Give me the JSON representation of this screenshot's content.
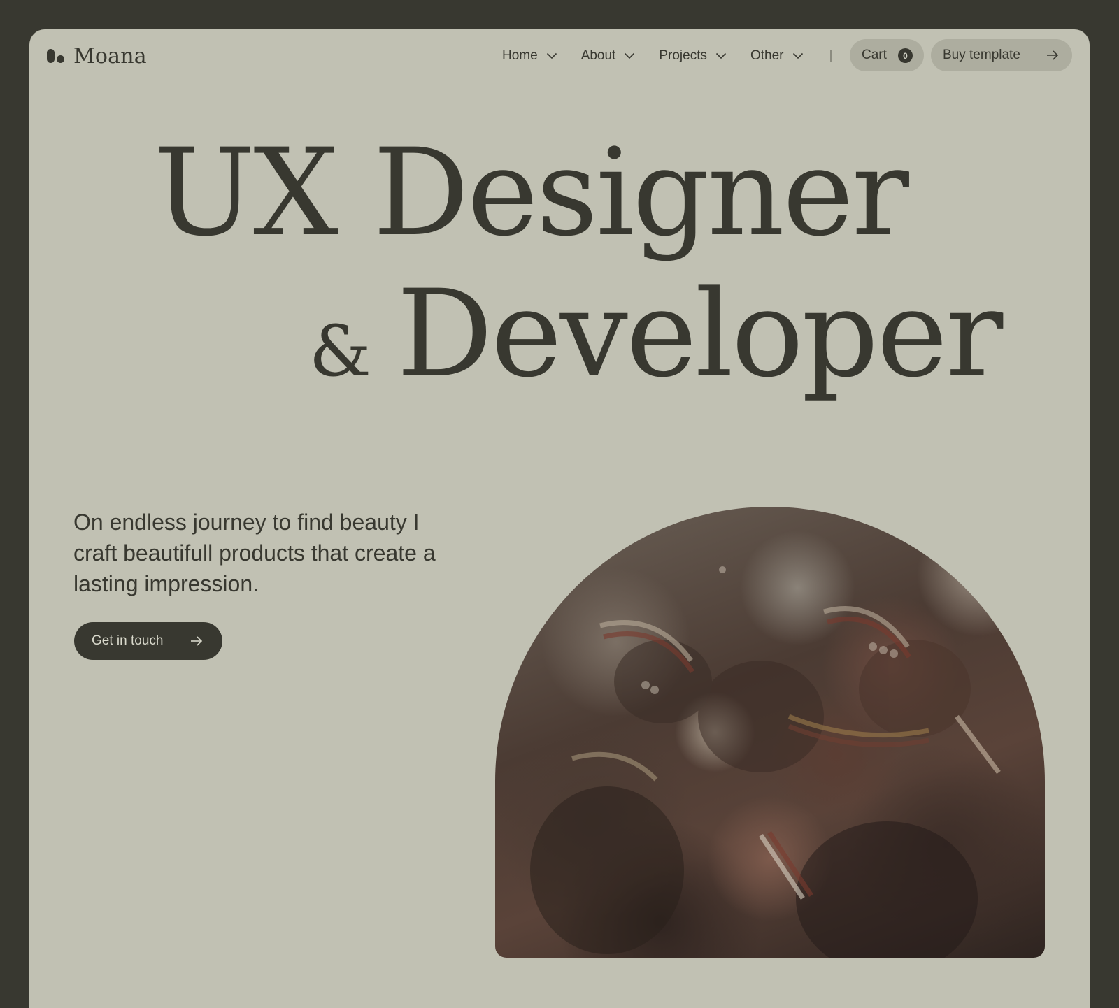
{
  "brand": {
    "name": "Moana"
  },
  "nav": {
    "items": [
      {
        "label": "Home"
      },
      {
        "label": "About"
      },
      {
        "label": "Projects"
      },
      {
        "label": "Other"
      }
    ]
  },
  "cart": {
    "label": "Cart",
    "count": "0"
  },
  "buy": {
    "label": "Buy template"
  },
  "hero": {
    "line1": "UX Designer",
    "amp": "&",
    "line2": "Developer"
  },
  "tagline": "On endless journey to find beauty I craft beautifull products that create a lasting impression.",
  "cta": {
    "label": "Get in touch"
  },
  "colors": {
    "page_bg": "#383830",
    "frame_bg": "#c1c1b3",
    "text": "#383830",
    "pill_bg": "#adad9f"
  },
  "icons": {
    "logo": "moana-logo-icon",
    "chevron": "chevron-down-icon",
    "arrow": "arrow-right-icon"
  }
}
